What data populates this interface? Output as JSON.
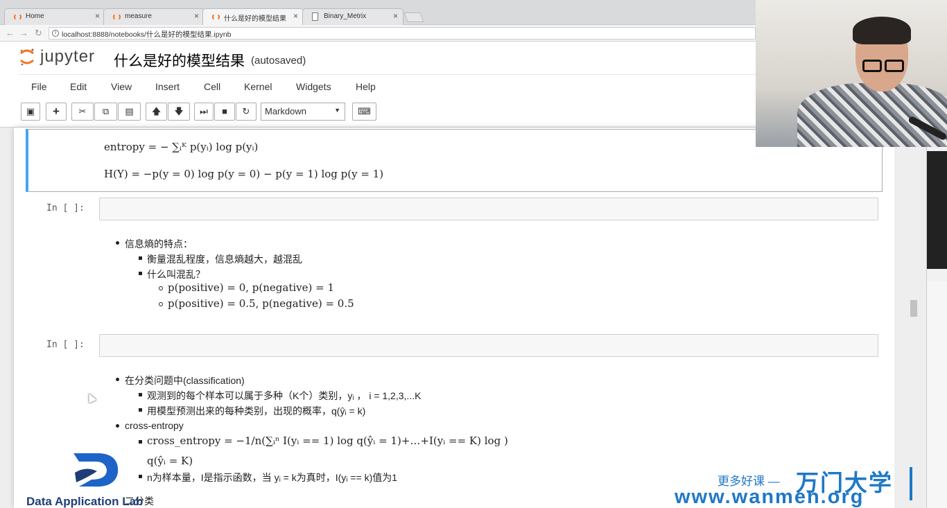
{
  "browser": {
    "tabs": [
      {
        "title": "Home"
      },
      {
        "title": "measure"
      },
      {
        "title": "什么是好的模型结果"
      },
      {
        "title": "Binary_Metrix"
      }
    ],
    "url": "localhost:8888/notebooks/什么是好的模型结果.ipynb"
  },
  "jupyter": {
    "logo_text": "jupyter",
    "notebook_title": "什么是好的模型结果",
    "autosave_status": "(autosaved)",
    "menu": [
      "File",
      "Edit",
      "View",
      "Insert",
      "Cell",
      "Kernel",
      "Widgets",
      "Help"
    ],
    "cell_type": "Markdown"
  },
  "cells": {
    "cell1": {
      "formula1": "entropy = − ∑ᵢᴷ p(yᵢ) log p(yᵢ)",
      "formula2": "H(Y) = −p(y = 0) log p(y = 0) − p(y = 1) log p(y = 1)"
    },
    "prompt": "In  [ ]:",
    "cell2": {
      "b1": "信息熵的特点：",
      "b1a": "衡量混乱程度，信息熵越大，越混乱",
      "b1b": "什么叫混乱？",
      "b1b1": "p(positive) = 0, p(negative) = 1",
      "b1b2": "p(positive) = 0.5, p(negative) = 0.5"
    },
    "cell3": {
      "b1": "在分类问题中(classification)",
      "b1a": "观测到的每个样本可以属于多种（K个）类别，yᵢ  ，  i = 1,2,3,...K",
      "b1b": "用模型预测出来的每种类别，出现的概率，q(ŷᵢ = k)",
      "b2": "cross-entropy",
      "b2a_formula": "cross_entropy = −1/n(∑ᵢⁿ I(yᵢ == 1) log q(ŷᵢ = 1)+…+I(yᵢ == K) log  )",
      "b2a_cont": "q(ŷᵢ = K)",
      "b2b": "n为样本量，I是指示函数，当 yᵢ = k为真时，I(yᵢ == k)值为1",
      "b3_partial": "二分类"
    }
  },
  "watermarks": {
    "left_org": "Data Application Lab",
    "right_slogan": "更多好课 —",
    "right_brand": "万门大学",
    "right_url": "www.wanmen.org"
  }
}
